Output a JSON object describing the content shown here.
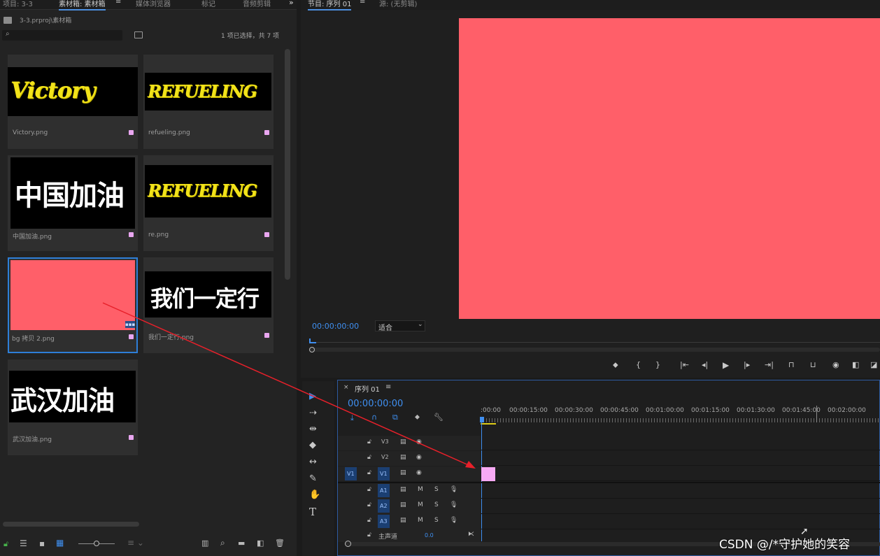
{
  "project_panel": {
    "tabs": [
      "项目: 3-3",
      "素材箱: 素材箱",
      "媒体浏览器",
      "标记",
      "音频剪辑"
    ],
    "breadcrumb": "3-3.prproj\\素材箱",
    "selection_status": "1 项已选择，共 7 项",
    "items": [
      {
        "file": "Victory.png",
        "art": "Victory"
      },
      {
        "file": "refueling.png",
        "art": "REFUELING"
      },
      {
        "file": "中国加油.png",
        "art": "中国加油"
      },
      {
        "file": "re.png",
        "art": "REFUELING"
      },
      {
        "file": "bg 拷贝 2.png",
        "art": ""
      },
      {
        "file": "我们一定行.png",
        "art": "我们一定行"
      },
      {
        "file": "武汉加油.png",
        "art": "武汉加油"
      }
    ]
  },
  "program_monitor": {
    "tabs": [
      "节目: 序列 01",
      "源: (无剪辑)"
    ],
    "timecode": "00:00:00:00",
    "fit_label": "适合",
    "frame_color": "#ff5f69"
  },
  "timeline": {
    "sequence_name": "序列 01",
    "timecode": "00:00:00:00",
    "ruler": [
      ":00:00",
      "00:00:15:00",
      "00:00:30:00",
      "00:00:45:00",
      "00:01:00:00",
      "00:01:15:00",
      "00:01:30:00",
      "00:01:45:00",
      "00:02:00:00"
    ],
    "video_tracks": [
      "V3",
      "V2",
      "V1"
    ],
    "source_patch": "V1",
    "audio_tracks": [
      "A1",
      "A2",
      "A3"
    ],
    "master_label": "主声道",
    "master_value": "0.0",
    "clip_color": "#f7a9f4"
  },
  "watermark": "CSDN @/*守护她的笑容"
}
